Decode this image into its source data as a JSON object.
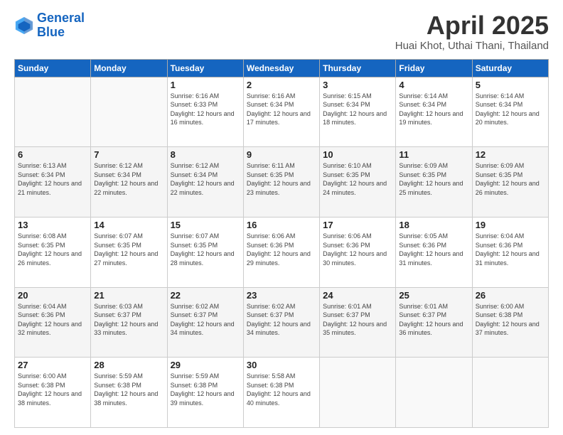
{
  "header": {
    "logo_line1": "General",
    "logo_line2": "Blue",
    "title": "April 2025",
    "subtitle": "Huai Khot, Uthai Thani, Thailand"
  },
  "calendar": {
    "days_of_week": [
      "Sunday",
      "Monday",
      "Tuesday",
      "Wednesday",
      "Thursday",
      "Friday",
      "Saturday"
    ],
    "weeks": [
      [
        {
          "day": "",
          "sunrise": "",
          "sunset": "",
          "daylight": ""
        },
        {
          "day": "",
          "sunrise": "",
          "sunset": "",
          "daylight": ""
        },
        {
          "day": "1",
          "sunrise": "Sunrise: 6:16 AM",
          "sunset": "Sunset: 6:33 PM",
          "daylight": "Daylight: 12 hours and 16 minutes."
        },
        {
          "day": "2",
          "sunrise": "Sunrise: 6:16 AM",
          "sunset": "Sunset: 6:34 PM",
          "daylight": "Daylight: 12 hours and 17 minutes."
        },
        {
          "day": "3",
          "sunrise": "Sunrise: 6:15 AM",
          "sunset": "Sunset: 6:34 PM",
          "daylight": "Daylight: 12 hours and 18 minutes."
        },
        {
          "day": "4",
          "sunrise": "Sunrise: 6:14 AM",
          "sunset": "Sunset: 6:34 PM",
          "daylight": "Daylight: 12 hours and 19 minutes."
        },
        {
          "day": "5",
          "sunrise": "Sunrise: 6:14 AM",
          "sunset": "Sunset: 6:34 PM",
          "daylight": "Daylight: 12 hours and 20 minutes."
        }
      ],
      [
        {
          "day": "6",
          "sunrise": "Sunrise: 6:13 AM",
          "sunset": "Sunset: 6:34 PM",
          "daylight": "Daylight: 12 hours and 21 minutes."
        },
        {
          "day": "7",
          "sunrise": "Sunrise: 6:12 AM",
          "sunset": "Sunset: 6:34 PM",
          "daylight": "Daylight: 12 hours and 22 minutes."
        },
        {
          "day": "8",
          "sunrise": "Sunrise: 6:12 AM",
          "sunset": "Sunset: 6:34 PM",
          "daylight": "Daylight: 12 hours and 22 minutes."
        },
        {
          "day": "9",
          "sunrise": "Sunrise: 6:11 AM",
          "sunset": "Sunset: 6:35 PM",
          "daylight": "Daylight: 12 hours and 23 minutes."
        },
        {
          "day": "10",
          "sunrise": "Sunrise: 6:10 AM",
          "sunset": "Sunset: 6:35 PM",
          "daylight": "Daylight: 12 hours and 24 minutes."
        },
        {
          "day": "11",
          "sunrise": "Sunrise: 6:09 AM",
          "sunset": "Sunset: 6:35 PM",
          "daylight": "Daylight: 12 hours and 25 minutes."
        },
        {
          "day": "12",
          "sunrise": "Sunrise: 6:09 AM",
          "sunset": "Sunset: 6:35 PM",
          "daylight": "Daylight: 12 hours and 26 minutes."
        }
      ],
      [
        {
          "day": "13",
          "sunrise": "Sunrise: 6:08 AM",
          "sunset": "Sunset: 6:35 PM",
          "daylight": "Daylight: 12 hours and 26 minutes."
        },
        {
          "day": "14",
          "sunrise": "Sunrise: 6:07 AM",
          "sunset": "Sunset: 6:35 PM",
          "daylight": "Daylight: 12 hours and 27 minutes."
        },
        {
          "day": "15",
          "sunrise": "Sunrise: 6:07 AM",
          "sunset": "Sunset: 6:35 PM",
          "daylight": "Daylight: 12 hours and 28 minutes."
        },
        {
          "day": "16",
          "sunrise": "Sunrise: 6:06 AM",
          "sunset": "Sunset: 6:36 PM",
          "daylight": "Daylight: 12 hours and 29 minutes."
        },
        {
          "day": "17",
          "sunrise": "Sunrise: 6:06 AM",
          "sunset": "Sunset: 6:36 PM",
          "daylight": "Daylight: 12 hours and 30 minutes."
        },
        {
          "day": "18",
          "sunrise": "Sunrise: 6:05 AM",
          "sunset": "Sunset: 6:36 PM",
          "daylight": "Daylight: 12 hours and 31 minutes."
        },
        {
          "day": "19",
          "sunrise": "Sunrise: 6:04 AM",
          "sunset": "Sunset: 6:36 PM",
          "daylight": "Daylight: 12 hours and 31 minutes."
        }
      ],
      [
        {
          "day": "20",
          "sunrise": "Sunrise: 6:04 AM",
          "sunset": "Sunset: 6:36 PM",
          "daylight": "Daylight: 12 hours and 32 minutes."
        },
        {
          "day": "21",
          "sunrise": "Sunrise: 6:03 AM",
          "sunset": "Sunset: 6:37 PM",
          "daylight": "Daylight: 12 hours and 33 minutes."
        },
        {
          "day": "22",
          "sunrise": "Sunrise: 6:02 AM",
          "sunset": "Sunset: 6:37 PM",
          "daylight": "Daylight: 12 hours and 34 minutes."
        },
        {
          "day": "23",
          "sunrise": "Sunrise: 6:02 AM",
          "sunset": "Sunset: 6:37 PM",
          "daylight": "Daylight: 12 hours and 34 minutes."
        },
        {
          "day": "24",
          "sunrise": "Sunrise: 6:01 AM",
          "sunset": "Sunset: 6:37 PM",
          "daylight": "Daylight: 12 hours and 35 minutes."
        },
        {
          "day": "25",
          "sunrise": "Sunrise: 6:01 AM",
          "sunset": "Sunset: 6:37 PM",
          "daylight": "Daylight: 12 hours and 36 minutes."
        },
        {
          "day": "26",
          "sunrise": "Sunrise: 6:00 AM",
          "sunset": "Sunset: 6:38 PM",
          "daylight": "Daylight: 12 hours and 37 minutes."
        }
      ],
      [
        {
          "day": "27",
          "sunrise": "Sunrise: 6:00 AM",
          "sunset": "Sunset: 6:38 PM",
          "daylight": "Daylight: 12 hours and 38 minutes."
        },
        {
          "day": "28",
          "sunrise": "Sunrise: 5:59 AM",
          "sunset": "Sunset: 6:38 PM",
          "daylight": "Daylight: 12 hours and 38 minutes."
        },
        {
          "day": "29",
          "sunrise": "Sunrise: 5:59 AM",
          "sunset": "Sunset: 6:38 PM",
          "daylight": "Daylight: 12 hours and 39 minutes."
        },
        {
          "day": "30",
          "sunrise": "Sunrise: 5:58 AM",
          "sunset": "Sunset: 6:38 PM",
          "daylight": "Daylight: 12 hours and 40 minutes."
        },
        {
          "day": "",
          "sunrise": "",
          "sunset": "",
          "daylight": ""
        },
        {
          "day": "",
          "sunrise": "",
          "sunset": "",
          "daylight": ""
        },
        {
          "day": "",
          "sunrise": "",
          "sunset": "",
          "daylight": ""
        }
      ]
    ]
  }
}
